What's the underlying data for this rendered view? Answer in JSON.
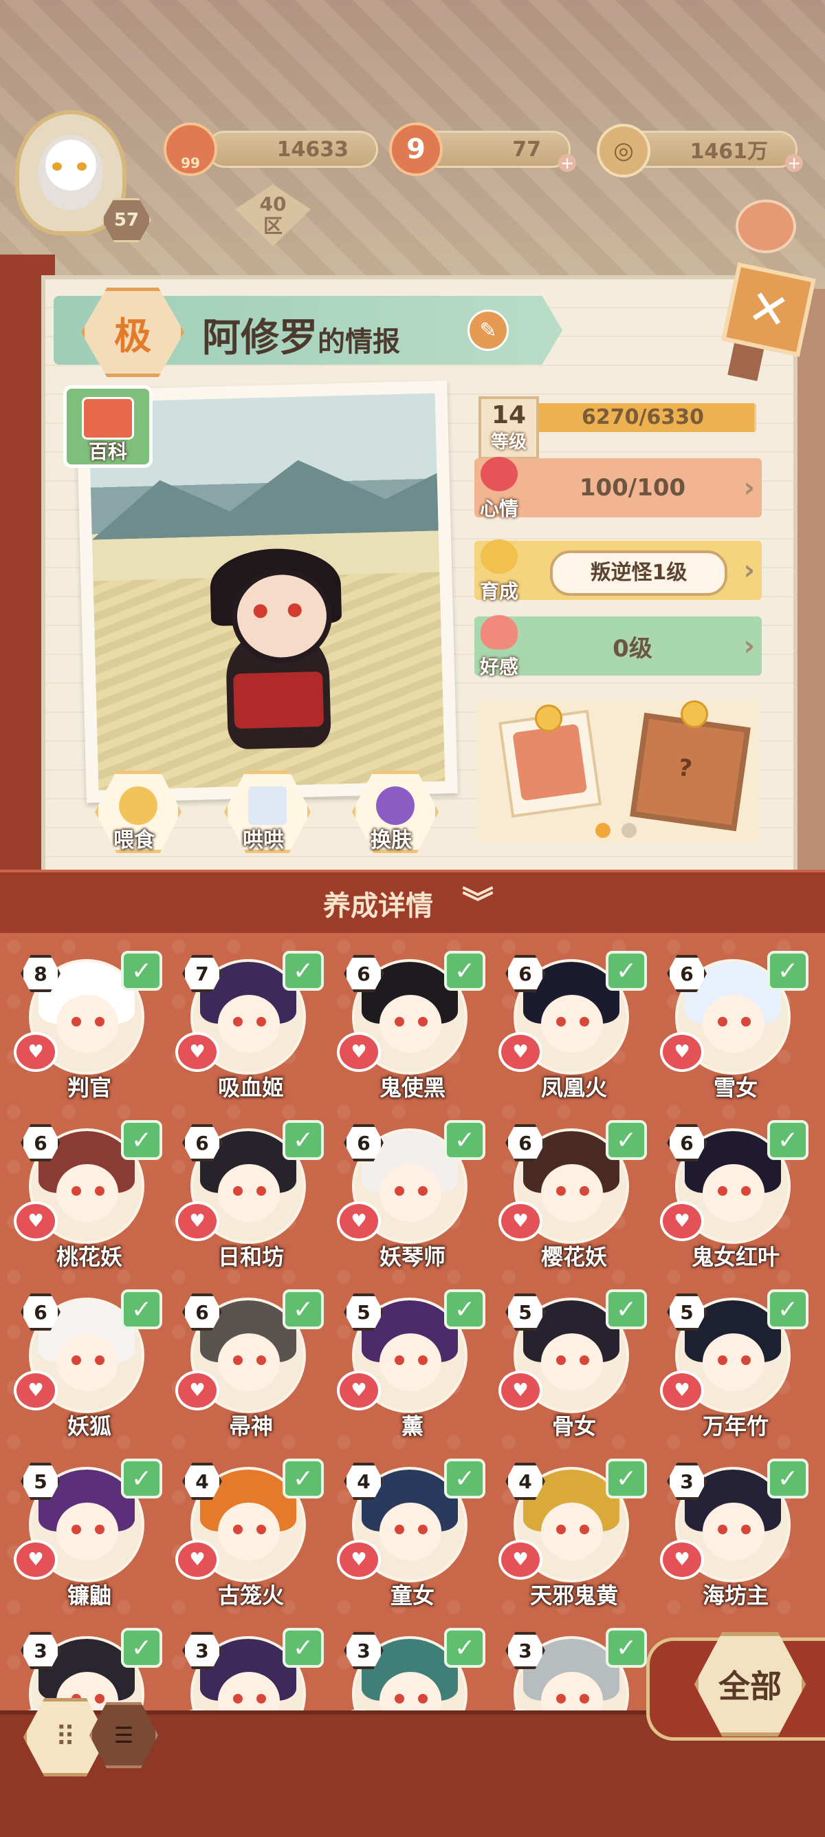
{
  "header": {
    "player_level": "57",
    "zone": {
      "number": "40",
      "label": "区"
    },
    "resources": [
      {
        "icon": "gem-icon",
        "badge": "99",
        "value": "14633"
      },
      {
        "icon": "stamina-icon",
        "value": "77"
      },
      {
        "icon": "coin-icon",
        "value": "1461万"
      }
    ]
  },
  "info": {
    "rank": "极",
    "name": "阿修罗",
    "name_suffix": "的情报",
    "wiki_label": "百科",
    "level": {
      "number": "14",
      "label": "等级",
      "exp": "6270/6330",
      "exp_fraction": 0.99
    },
    "mood": {
      "label": "心情",
      "value": "100/100"
    },
    "growth": {
      "label": "育成",
      "value": "叛逆怪1级"
    },
    "favor": {
      "label": "好感",
      "value": "0级"
    },
    "actions": [
      {
        "name": "feed",
        "label": "喂食"
      },
      {
        "name": "coax",
        "label": "哄哄"
      },
      {
        "name": "skin",
        "label": "换肤"
      }
    ],
    "pager": {
      "current": 1,
      "total": 2
    }
  },
  "details_label": "养成详情",
  "roster": [
    {
      "level": "8",
      "name": "判官",
      "hair": "#ffffff"
    },
    {
      "level": "7",
      "name": "吸血姬",
      "hair": "#3b2a5a"
    },
    {
      "level": "6",
      "name": "鬼使黑",
      "hair": "#1e1b1f"
    },
    {
      "level": "6",
      "name": "凤凰火",
      "hair": "#1a1b2e"
    },
    {
      "level": "6",
      "name": "雪女",
      "hair": "#e8f1fb"
    },
    {
      "level": "6",
      "name": "桃花妖",
      "hair": "#8a3b33"
    },
    {
      "level": "6",
      "name": "日和坊",
      "hair": "#26242a"
    },
    {
      "level": "6",
      "name": "妖琴师",
      "hair": "#f2efec"
    },
    {
      "level": "6",
      "name": "樱花妖",
      "hair": "#4a2b24"
    },
    {
      "level": "6",
      "name": "鬼女红叶",
      "hair": "#1f1a30"
    },
    {
      "level": "6",
      "name": "妖狐",
      "hair": "#f5f3f2"
    },
    {
      "level": "6",
      "name": "帚神",
      "hair": "#5a5450"
    },
    {
      "level": "5",
      "name": "薰",
      "hair": "#4d2a6a"
    },
    {
      "level": "5",
      "name": "骨女",
      "hair": "#27222e"
    },
    {
      "level": "5",
      "name": "万年竹",
      "hair": "#1c2030"
    },
    {
      "level": "5",
      "name": "镰鼬",
      "hair": "#5b2f7a"
    },
    {
      "level": "4",
      "name": "古笼火",
      "hair": "#e57a2a"
    },
    {
      "level": "4",
      "name": "童女",
      "hair": "#2a3a5e"
    },
    {
      "level": "4",
      "name": "天邪鬼黄",
      "hair": "#d9a93a"
    },
    {
      "level": "3",
      "name": "海坊主",
      "hair": "#252238"
    },
    {
      "level": "3",
      "name": "",
      "hair": "#2a2630"
    },
    {
      "level": "3",
      "name": "",
      "hair": "#3d2a5a"
    },
    {
      "level": "3",
      "name": "",
      "hair": "#3f7f78"
    },
    {
      "level": "3",
      "name": "",
      "hair": "#b7bdbf"
    }
  ],
  "filter_label": "全部"
}
